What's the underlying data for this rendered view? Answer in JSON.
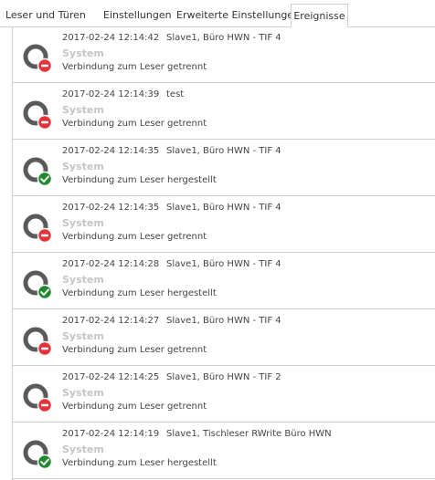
{
  "tabs": [
    {
      "label": "Leser und Türen",
      "active": false
    },
    {
      "label": "Einstellungen",
      "active": false
    },
    {
      "label": "Erweiterte Einstellungen",
      "active": false
    },
    {
      "label": "Ereignisse",
      "active": true
    }
  ],
  "status_colors": {
    "disconnected": "#e8323a",
    "connected": "#1e8a2b",
    "ring": "#5a5a5a"
  },
  "events": [
    {
      "timestamp": "2017-02-24 12:14:42",
      "source": "Slave1, Büro HWN - TIF 4",
      "category": "System",
      "message": "Verbindung zum Leser getrennt",
      "status": "disconnected",
      "icon": "reader-disconnected-icon"
    },
    {
      "timestamp": "2017-02-24 12:14:39",
      "source": "test",
      "category": "System",
      "message": "Verbindung zum Leser getrennt",
      "status": "disconnected",
      "icon": "reader-disconnected-icon"
    },
    {
      "timestamp": "2017-02-24 12:14:35",
      "source": "Slave1, Büro HWN - TIF 4",
      "category": "System",
      "message": "Verbindung zum Leser hergestellt",
      "status": "connected",
      "icon": "reader-connected-icon"
    },
    {
      "timestamp": "2017-02-24 12:14:35",
      "source": "Slave1, Büro HWN - TIF 4",
      "category": "System",
      "message": "Verbindung zum Leser getrennt",
      "status": "disconnected",
      "icon": "reader-disconnected-icon"
    },
    {
      "timestamp": "2017-02-24 12:14:28",
      "source": "Slave1, Büro HWN - TIF 4",
      "category": "System",
      "message": "Verbindung zum Leser hergestellt",
      "status": "connected",
      "icon": "reader-connected-icon"
    },
    {
      "timestamp": "2017-02-24 12:14:27",
      "source": "Slave1, Büro HWN - TIF 4",
      "category": "System",
      "message": "Verbindung zum Leser getrennt",
      "status": "disconnected",
      "icon": "reader-disconnected-icon"
    },
    {
      "timestamp": "2017-02-24 12:14:25",
      "source": "Slave1, Büro HWN - TIF 2",
      "category": "System",
      "message": "Verbindung zum Leser getrennt",
      "status": "disconnected",
      "icon": "reader-disconnected-icon"
    },
    {
      "timestamp": "2017-02-24 12:14:19",
      "source": "Slave1, Tischleser RWrite Büro HWN",
      "category": "System",
      "message": "Verbindung zum Leser hergestellt",
      "status": "connected",
      "icon": "reader-connected-icon"
    }
  ]
}
